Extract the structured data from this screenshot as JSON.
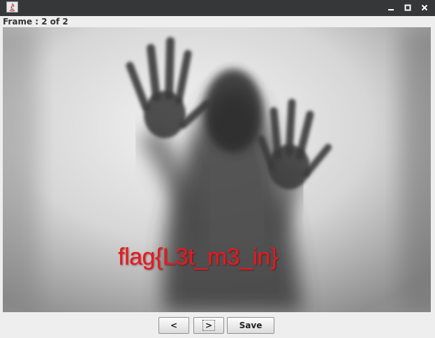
{
  "window": {
    "controls": [
      "minimize-icon",
      "maximize-icon",
      "close-icon"
    ]
  },
  "frame_label": "Frame : 2 of 2",
  "image": {
    "overlay_text": "flag{L3t_m3_in}",
    "overlay_color": "#e8191f"
  },
  "buttons": {
    "prev_label": "<",
    "next_label": ">",
    "save_label": "Save"
  }
}
